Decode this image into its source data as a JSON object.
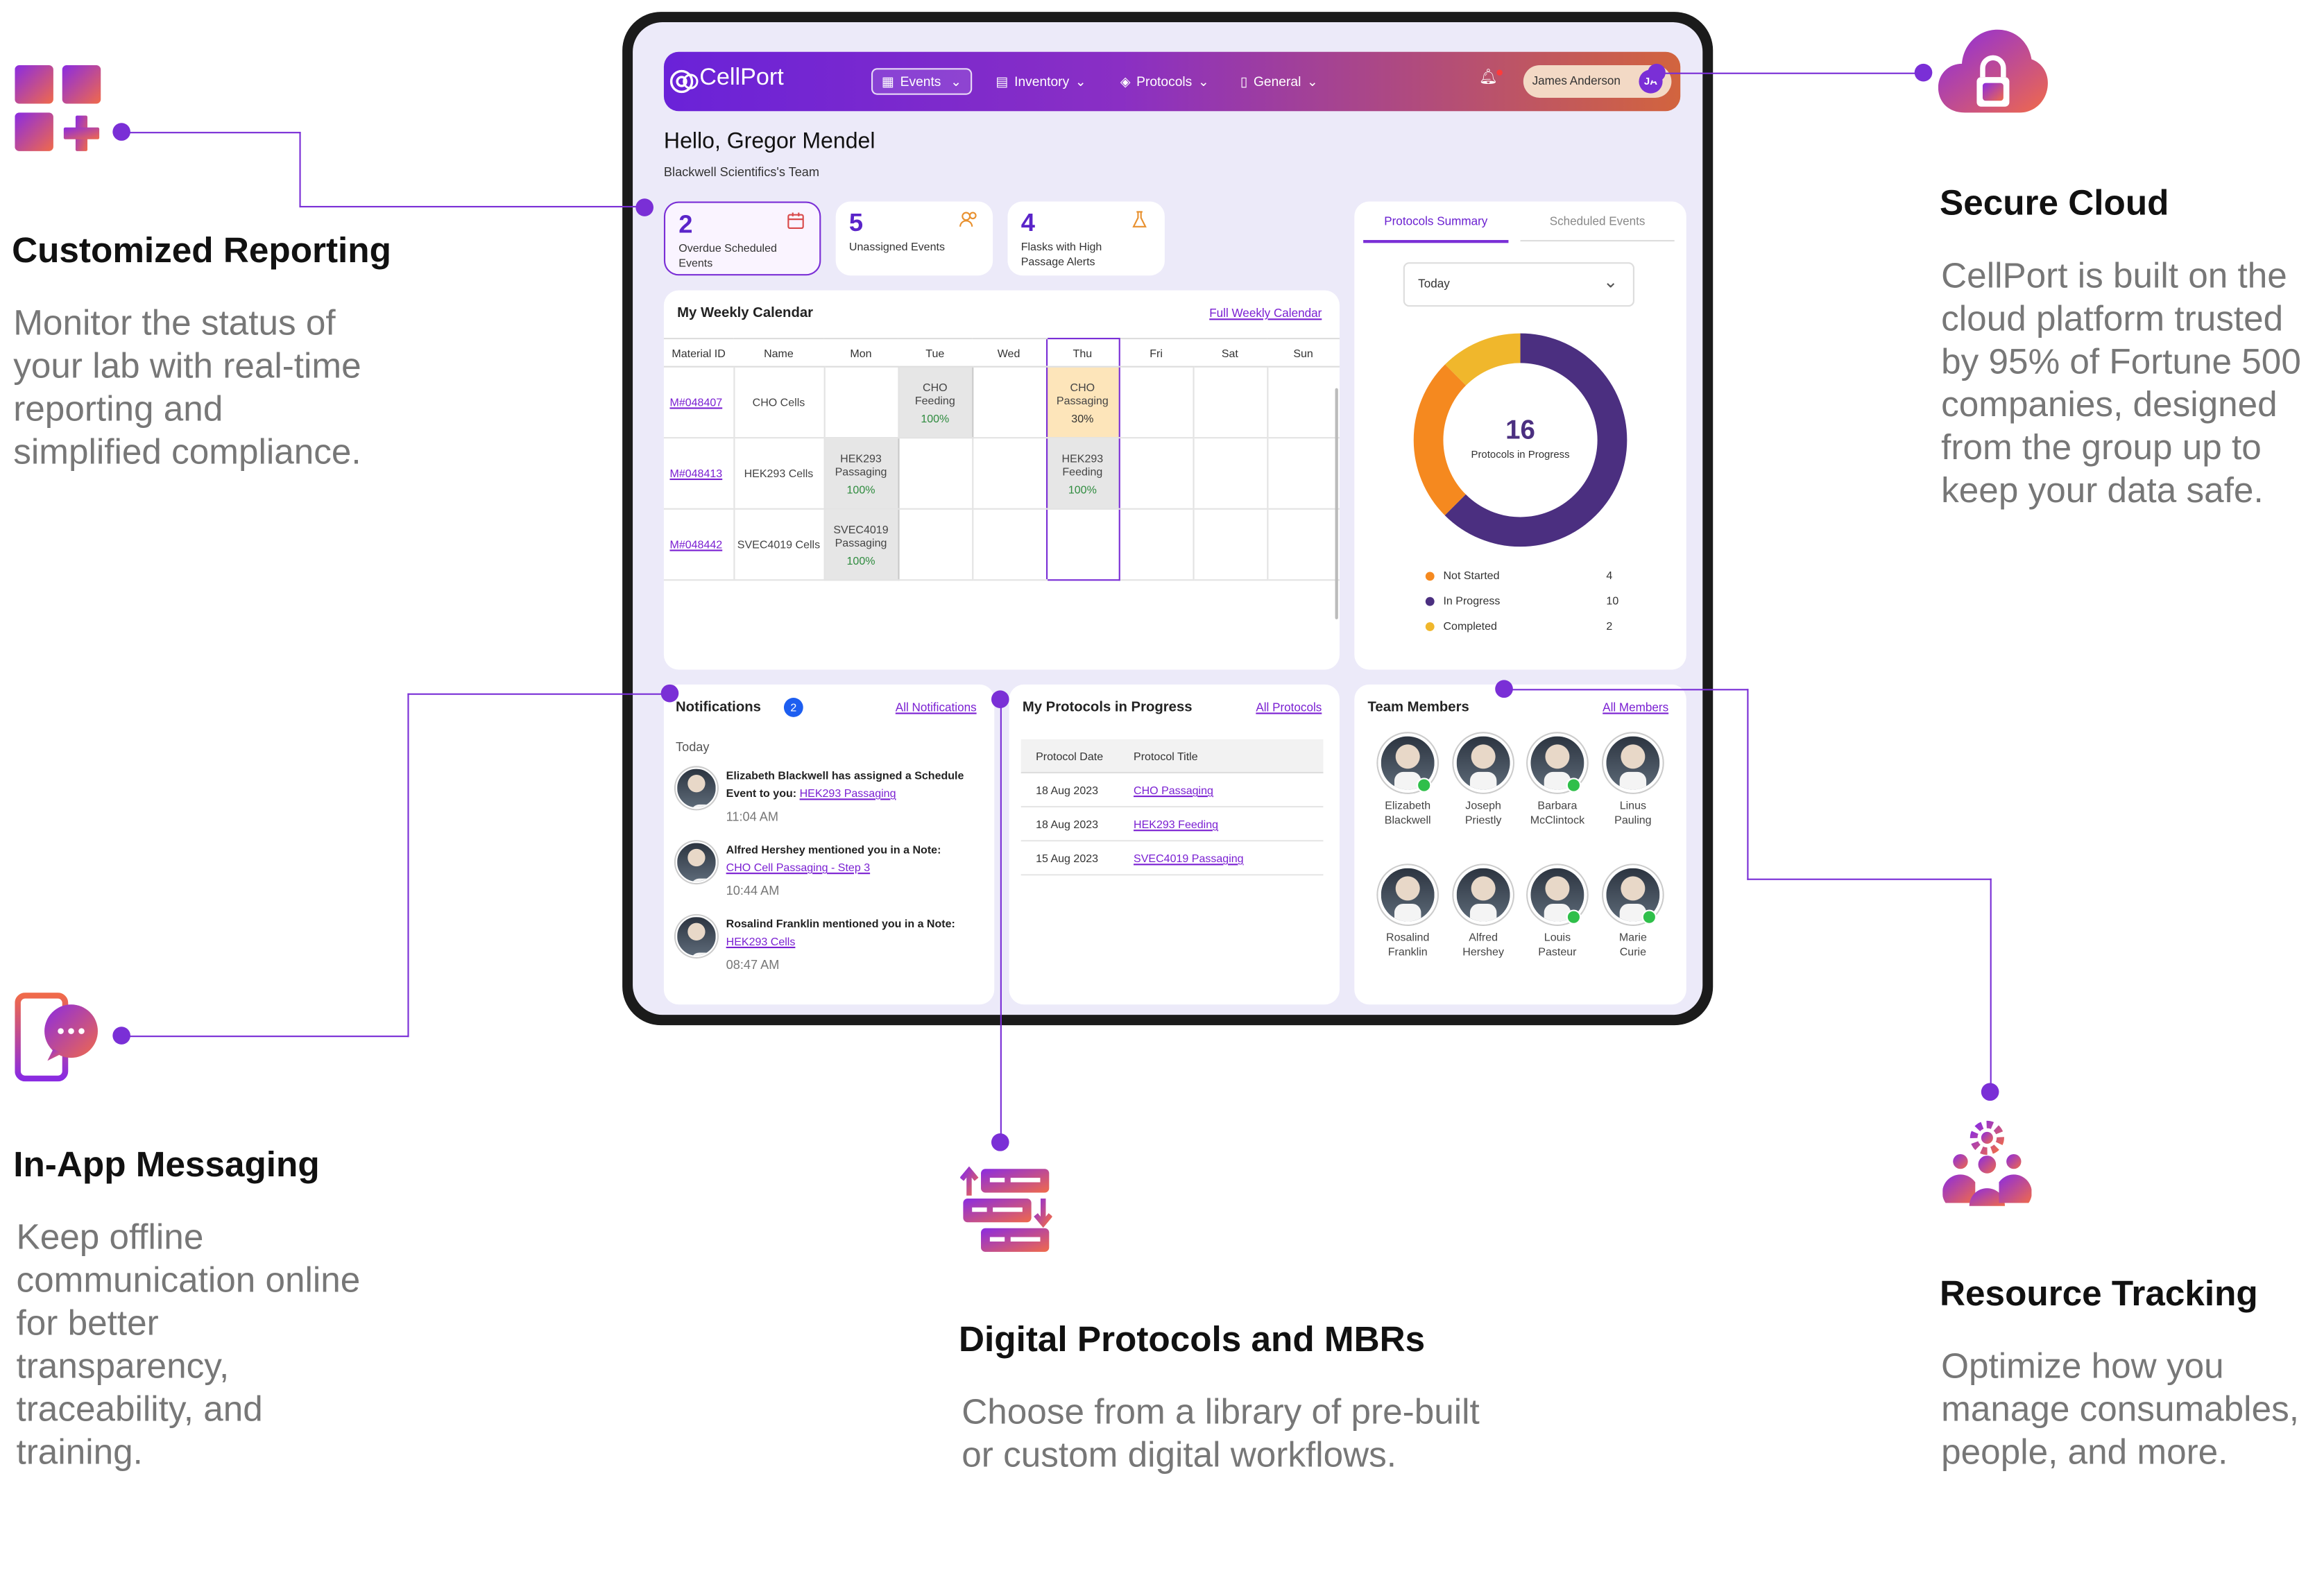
{
  "features": {
    "reporting": {
      "title": "Customized Reporting",
      "lines": [
        "Monitor the status of",
        "your lab with real-time",
        "reporting and",
        "simplified compliance."
      ]
    },
    "cloud": {
      "title": "Secure Cloud",
      "lines": [
        "CellPort is built on the",
        "cloud platform trusted",
        "by 95% of Fortune 500",
        "companies, designed",
        "from the group up to",
        "keep your data safe."
      ]
    },
    "messaging": {
      "title": "In-App Messaging",
      "lines": [
        "Keep offline",
        "communication online",
        "for better",
        "transparency,",
        "traceability, and",
        "training."
      ]
    },
    "protocols": {
      "title": "Digital Protocols and MBRs",
      "lines": [
        "Choose from a library of pre-built",
        "or custom digital workflows."
      ]
    },
    "tracking": {
      "title": "Resource Tracking",
      "lines": [
        "Optimize how you",
        "manage consumables,",
        "people, and more."
      ]
    }
  },
  "app": {
    "logo": "CellPort",
    "nav": {
      "events": "Events",
      "inventory": "Inventory",
      "protocols": "Protocols",
      "general": "General"
    },
    "user": {
      "name": "James Anderson",
      "initials": "JA"
    },
    "greeting": "Hello, Gregor Mendel",
    "team": "Blackwell Scientifics's Team",
    "stats": [
      {
        "value": "2",
        "label": "Overdue Scheduled Events"
      },
      {
        "value": "5",
        "label": "Unassigned Events"
      },
      {
        "value": "4",
        "label": "Flasks with High Passage Alerts"
      }
    ],
    "calendar": {
      "title": "My Weekly Calendar",
      "link": "Full Weekly Calendar",
      "headers": [
        "Material ID",
        "Name",
        "Mon",
        "Tue",
        "Wed",
        "Thu",
        "Fri",
        "Sat",
        "Sun"
      ],
      "rows": [
        {
          "id": "M#048407",
          "name": "CHO Cells"
        },
        {
          "id": "M#048413",
          "name": "HEK293 Cells"
        },
        {
          "id": "M#048442",
          "name": "SVEC4019 Cells"
        }
      ],
      "events": {
        "r0_tue": {
          "l1": "CHO",
          "l2": "Feeding",
          "pct": "100%"
        },
        "r0_thu": {
          "l1": "CHO",
          "l2": "Passaging",
          "pct": "30%"
        },
        "r1_mon": {
          "l1": "HEK293",
          "l2": "Passaging",
          "pct": "100%"
        },
        "r1_thu": {
          "l1": "HEK293",
          "l2": "Feeding",
          "pct": "100%"
        },
        "r2_mon": {
          "l1": "SVEC4019",
          "l2": "Passaging",
          "pct": "100%"
        }
      }
    },
    "summary": {
      "tabs": [
        "Protocols Summary",
        "Scheduled Events"
      ],
      "period": "Today",
      "total": "16",
      "total_label": "Protocols in Progress",
      "legend": [
        {
          "label": "Not Started",
          "value": 4,
          "color": "#f5891f"
        },
        {
          "label": "In Progress",
          "value": 10,
          "color": "#4b2f80"
        },
        {
          "label": "Completed",
          "value": 2,
          "color": "#f0b72c"
        }
      ]
    },
    "notifications": {
      "title": "Notifications",
      "count": "2",
      "link": "All Notifications",
      "group": "Today",
      "items": [
        {
          "text": "Elizabeth Blackwell has assigned a Schedule Event to you: ",
          "link": "HEK293 Passaging",
          "time": "11:04 AM"
        },
        {
          "text": "Alfred Hershey mentioned you in a Note:",
          "link": "CHO Cell Passaging - Step 3",
          "time": "10:44 AM"
        },
        {
          "text": "Rosalind Franklin mentioned you in a Note:",
          "link": "HEK293 Cells",
          "time": "08:47 AM"
        }
      ]
    },
    "my_protocols": {
      "title": "My Protocols in Progress",
      "link": "All Protocols",
      "headers": [
        "Protocol Date",
        "Protocol Title"
      ],
      "rows": [
        {
          "date": "18 Aug 2023",
          "title": "CHO Passaging"
        },
        {
          "date": "18 Aug 2023",
          "title": "HEK293 Feeding"
        },
        {
          "date": "15 Aug 2023",
          "title": "SVEC4019 Passaging"
        }
      ]
    },
    "team_members": {
      "title": "Team Members",
      "link": "All Members",
      "people": [
        {
          "first": "Elizabeth",
          "last": "Blackwell",
          "online": true
        },
        {
          "first": "Joseph",
          "last": "Priestly",
          "online": false
        },
        {
          "first": "Barbara",
          "last": "McClintock",
          "online": true
        },
        {
          "first": "Linus",
          "last": "Pauling",
          "online": false
        },
        {
          "first": "Rosalind",
          "last": "Franklin",
          "online": false
        },
        {
          "first": "Alfred",
          "last": "Hershey",
          "online": false
        },
        {
          "first": "Louis",
          "last": "Pasteur",
          "online": true
        },
        {
          "first": "Marie",
          "last": "Curie",
          "online": true
        }
      ]
    }
  }
}
